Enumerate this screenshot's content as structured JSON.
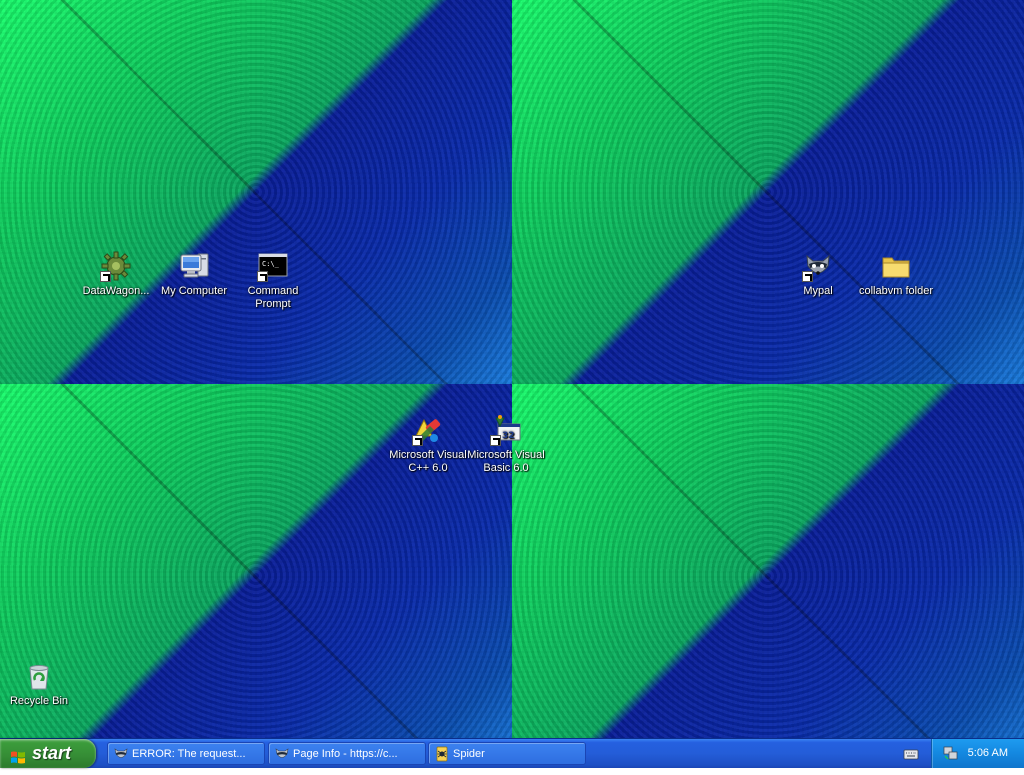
{
  "desktop": {
    "icons": [
      {
        "label": "DataWagon...",
        "icon": "gear-icon",
        "shortcut": true
      },
      {
        "label": "My Computer",
        "icon": "computer-icon",
        "shortcut": false
      },
      {
        "label": "Command Prompt",
        "icon": "command-prompt-icon",
        "shortcut": true
      },
      {
        "label": "Mypal",
        "icon": "raccoon-icon",
        "shortcut": true
      },
      {
        "label": "collabvm folder",
        "icon": "folder-icon",
        "shortcut": false
      },
      {
        "label": "Microsoft Visual C++ 6.0",
        "icon": "visual-cpp-icon",
        "shortcut": true
      },
      {
        "label": "Microsoft Visual Basic 6.0",
        "icon": "visual-basic-icon",
        "shortcut": true
      },
      {
        "label": "Recycle Bin",
        "icon": "recycle-bin-icon",
        "shortcut": false
      }
    ]
  },
  "taskbar": {
    "start_label": "start",
    "tasks": [
      {
        "label": "ERROR: The request...",
        "icon": "raccoon-icon"
      },
      {
        "label": "Page Info - https://c...",
        "icon": "raccoon-icon"
      },
      {
        "label": "Spider",
        "icon": "spider-solitaire-icon"
      }
    ],
    "tray": {
      "clock": "5:06 AM",
      "tray_icon": "network-icon",
      "keyboard_icon": "keyboard-icon"
    }
  },
  "colors": {
    "taskbar": "#245dd8",
    "start_button": "#368e36",
    "tray": "#1488e0",
    "wallpaper_green": "#1aff6e",
    "wallpaper_blue": "#0a1f9c"
  }
}
